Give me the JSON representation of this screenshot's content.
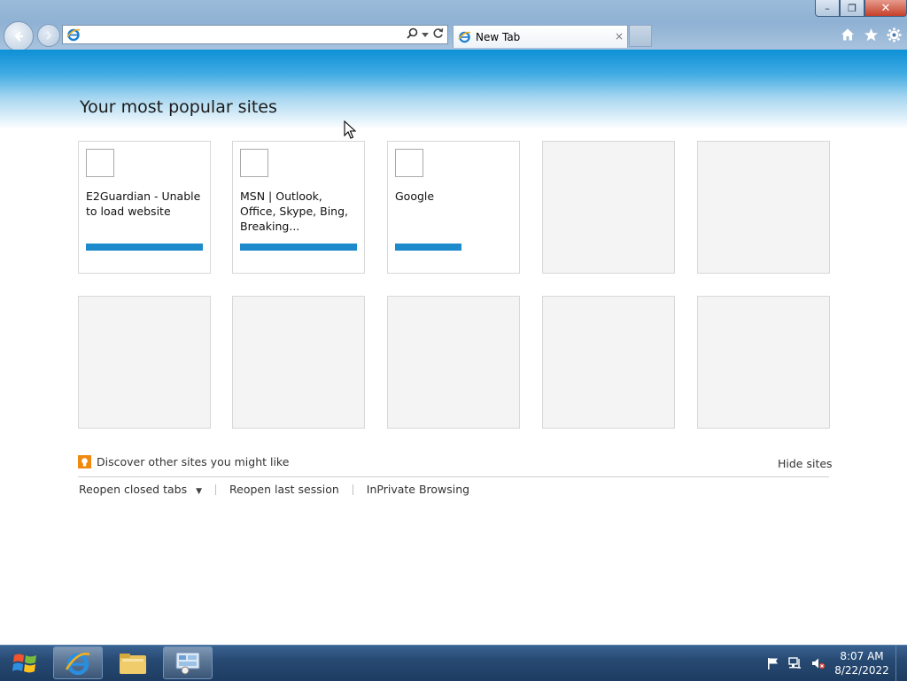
{
  "browser": {
    "address": {
      "value": "",
      "placeholder": ""
    },
    "tab": {
      "title": "New Tab",
      "close_glyph": "×"
    },
    "window_controls": {
      "minimize": "–",
      "restore": "❐",
      "close": "✕"
    },
    "toolbar_icons": [
      "home-icon",
      "favorites-star-icon",
      "settings-gear-icon"
    ]
  },
  "new_tab_page": {
    "heading": "Your most popular sites",
    "tiles": [
      {
        "label": "E2Guardian - Unable to load website",
        "usage": 1.0
      },
      {
        "label": "MSN | Outlook, Office, Skype, Bing, Breaking...",
        "usage": 1.0
      },
      {
        "label": "Google",
        "usage": 0.57
      },
      {
        "label": "",
        "usage": 0
      },
      {
        "label": "",
        "usage": 0
      },
      {
        "label": "",
        "usage": 0
      },
      {
        "label": "",
        "usage": 0
      },
      {
        "label": "",
        "usage": 0
      },
      {
        "label": "",
        "usage": 0
      },
      {
        "label": "",
        "usage": 0
      }
    ],
    "discover_text": "Discover other sites you might like",
    "hide_sites": "Hide sites",
    "links": {
      "reopen_closed_tabs": "Reopen closed tabs",
      "reopen_last_session": "Reopen last session",
      "inprivate": "InPrivate Browsing"
    }
  },
  "taskbar": {
    "clock_time": "8:07 AM",
    "clock_date": "8/22/2022",
    "pinned": [
      "internet-explorer-icon",
      "file-explorer-icon",
      "server-manager-icon"
    ]
  },
  "colors": {
    "accent_bar": "#1d8acb",
    "header_blue": "#0c8fd6",
    "discover_orange": "#f08a0f"
  }
}
